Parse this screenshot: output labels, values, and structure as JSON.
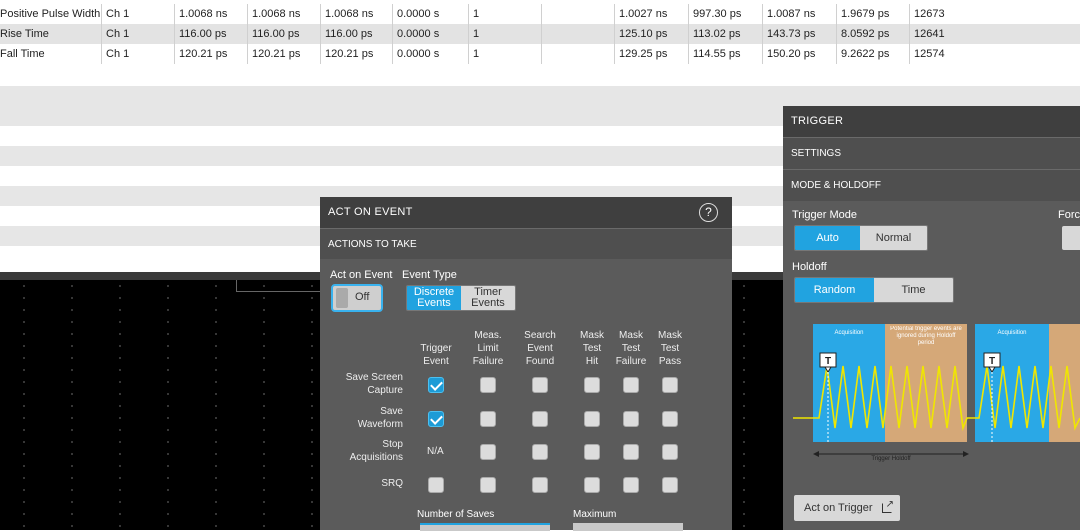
{
  "measurements": [
    {
      "name": "Positive Pulse Width",
      "source": "Ch 1",
      "v1": "1.0068 ns",
      "v2": "1.0068 ns",
      "v3": "1.0068 ns",
      "v4": "0.0000 s",
      "v5": "1",
      "v6": "",
      "v7": "1.0027 ns",
      "v8": "997.30 ps",
      "v9": "1.0087 ns",
      "v10": "1.9679 ps",
      "v11": "12673"
    },
    {
      "name": "Rise Time",
      "source": "Ch 1",
      "v1": "116.00 ps",
      "v2": "116.00 ps",
      "v3": "116.00 ps",
      "v4": "0.0000 s",
      "v5": "1",
      "v6": "",
      "v7": "125.10 ps",
      "v8": "113.02 ps",
      "v9": "143.73 ps",
      "v10": "8.0592 ps",
      "v11": "12641"
    },
    {
      "name": "Fall Time",
      "source": "Ch 1",
      "v1": "120.21 ps",
      "v2": "120.21 ps",
      "v3": "120.21 ps",
      "v4": "0.0000 s",
      "v5": "1",
      "v6": "",
      "v7": "129.25 ps",
      "v8": "114.55 ps",
      "v9": "150.20 ps",
      "v10": "9.2622 ps",
      "v11": "12574"
    }
  ],
  "act_on_event": {
    "title": "ACT ON EVENT",
    "section": "ACTIONS TO TAKE",
    "help": "?",
    "act_label": "Act on Event",
    "toggle": "Off",
    "event_type_label": "Event Type",
    "event_types": [
      "Discrete\nEvents",
      "Timer\nEvents"
    ],
    "columns": [
      "Trigger\nEvent",
      "Meas.\nLimit\nFailure",
      "Search\nEvent\nFound",
      "Mask\nTest\nHit",
      "Mask\nTest\nFailure",
      "Mask\nTest\nPass"
    ],
    "rows": [
      "Save Screen\nCapture",
      "Save\nWaveform",
      "Stop\nAcquisitions",
      "SRQ"
    ],
    "na": "N/A",
    "checked": [
      [
        true,
        false,
        false,
        false,
        false,
        false
      ],
      [
        true,
        false,
        false,
        false,
        false,
        false
      ],
      [
        null,
        false,
        false,
        false,
        false,
        false
      ],
      [
        false,
        false,
        false,
        false,
        false,
        false
      ]
    ],
    "number_of_saves": "Number of Saves",
    "maximum": "Maximum"
  },
  "trigger": {
    "title": "TRIGGER",
    "settings": "SETTINGS",
    "mode_holdoff": "MODE & HOLDOFF",
    "mode_label": "Trigger Mode",
    "modes": [
      "Auto",
      "Normal"
    ],
    "force_label": "Forc",
    "holdoff_label": "Holdoff",
    "holdoffs": [
      "Random",
      "Time"
    ],
    "diagram": {
      "acq1": "Acquisition",
      "ignored": "Potential trigger events are ignored during Holdoff period",
      "acq2": "Acquisition",
      "marker": "T",
      "holdoff": "Trigger Holdoff"
    },
    "act_button": "Act on Trigger"
  },
  "colors": {
    "accent": "#21a3e0",
    "acq_blue": "#2aa8e6",
    "holdoff_orange": "#d5a878",
    "wave": "#f0e600"
  }
}
